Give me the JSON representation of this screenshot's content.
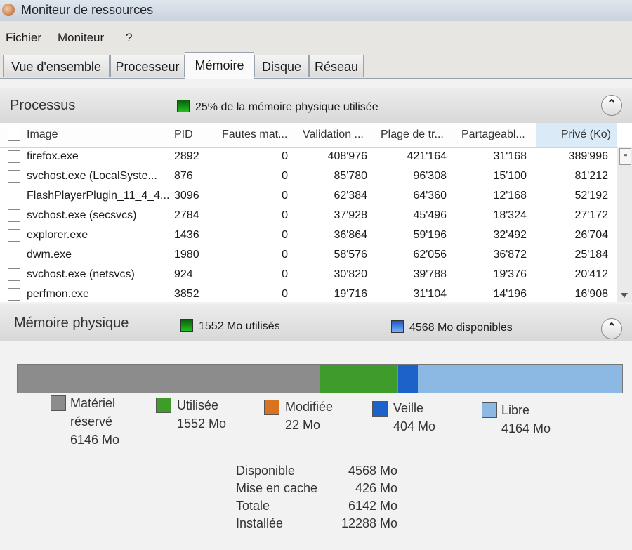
{
  "window": {
    "title": "Moniteur de ressources",
    "icon": "resource-monitor-icon"
  },
  "menu": {
    "items": [
      "Fichier",
      "Moniteur",
      "?"
    ]
  },
  "tabs": [
    {
      "label": "Vue d'ensemble",
      "active": false
    },
    {
      "label": "Processeur",
      "active": false
    },
    {
      "label": "Mémoire",
      "active": true
    },
    {
      "label": "Disque",
      "active": false
    },
    {
      "label": "Réseau",
      "active": false
    }
  ],
  "processes": {
    "title": "Processus",
    "summary": "25% de la mémoire physique utilisée",
    "columns": [
      "Image",
      "PID",
      "Fautes mat...",
      "Validation ...",
      "Plage de tr...",
      "Partageabl...",
      "Privé (Ko)"
    ],
    "rows": [
      [
        "firefox.exe",
        "2892",
        "0",
        "408'976",
        "421'164",
        "31'168",
        "389'996"
      ],
      [
        "svchost.exe (LocalSyste...",
        "876",
        "0",
        "85'780",
        "96'308",
        "15'100",
        "81'212"
      ],
      [
        "FlashPlayerPlugin_11_4_4...",
        "3096",
        "0",
        "62'384",
        "64'360",
        "12'168",
        "52'192"
      ],
      [
        "svchost.exe (secsvcs)",
        "2784",
        "0",
        "37'928",
        "45'496",
        "18'324",
        "27'172"
      ],
      [
        "explorer.exe",
        "1436",
        "0",
        "36'864",
        "59'196",
        "32'492",
        "26'704"
      ],
      [
        "dwm.exe",
        "1980",
        "0",
        "58'576",
        "62'056",
        "36'872",
        "25'184"
      ],
      [
        "svchost.exe (netsvcs)",
        "924",
        "0",
        "30'820",
        "39'788",
        "19'376",
        "20'412"
      ],
      [
        "perfmon.exe",
        "3852",
        "0",
        "19'716",
        "31'104",
        "14'196",
        "16'908"
      ]
    ]
  },
  "physical": {
    "title": "Mémoire physique",
    "used": "1552 Mo utilisés",
    "available": "4568 Mo disponibles",
    "bar": [
      {
        "name": "reserved",
        "mb": 6146,
        "color": "#8c8c8c"
      },
      {
        "name": "used",
        "mb": 1552,
        "color": "#3f9b2a"
      },
      {
        "name": "modified",
        "mb": 22,
        "color": "#d9731f"
      },
      {
        "name": "standby",
        "mb": 404,
        "color": "#1c62c9"
      },
      {
        "name": "free",
        "mb": 4164,
        "color": "#8cb8e4"
      }
    ],
    "legend": [
      {
        "line1": "Matériel",
        "line2": "réservé",
        "line3": "6146 Mo",
        "color": "#8c8c8c"
      },
      {
        "line1": "Utilisée",
        "line2": "1552 Mo",
        "color": "#3f9b2a"
      },
      {
        "line1": "Modifiée",
        "line2": "22 Mo",
        "color": "#d9731f"
      },
      {
        "line1": "Veille",
        "line2": "404 Mo",
        "color": "#1c62c9"
      },
      {
        "line1": "Libre",
        "line2": "4164 Mo",
        "color": "#8cb8e4"
      }
    ],
    "stats": [
      {
        "label": "Disponible",
        "value": "4568 Mo"
      },
      {
        "label": "Mise en cache",
        "value": "426 Mo"
      },
      {
        "label": "Totale",
        "value": "6142 Mo"
      },
      {
        "label": "Installée",
        "value": "12288 Mo"
      }
    ]
  }
}
